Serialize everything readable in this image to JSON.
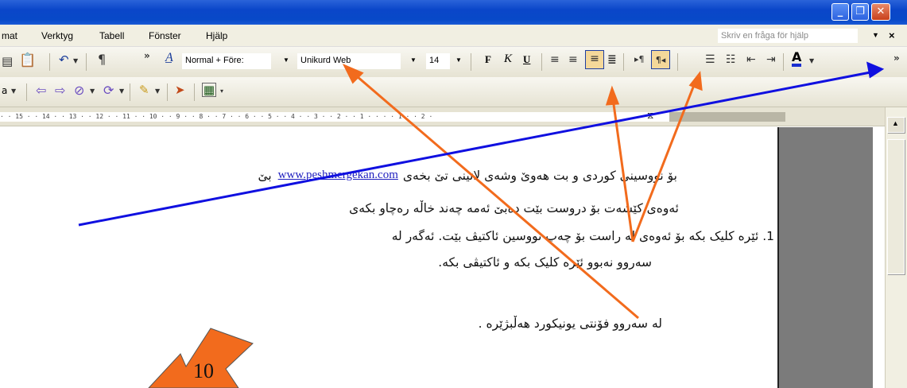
{
  "menubar": {
    "items": [
      "mat",
      "Verktyg",
      "Tabell",
      "Fönster",
      "Hjälp"
    ],
    "help_placeholder": "Skriv en fråga för hjälp"
  },
  "toolbar": {
    "style": "Normal + Före:",
    "font": "Unikurd Web",
    "size": "14",
    "bold": "F",
    "italic": "K",
    "underline": "U",
    "pilcrow": "¶",
    "font_color_letter": "A",
    "more": "»"
  },
  "toolbar2": {
    "left_label": "a"
  },
  "ruler": {
    "ticks": "· · 15 · · 14 · · 13 · · 12 · · 11 · · 10 · · 9 · · 8 · · 7 · · 6 · · 5 · · 4 · · 3 · · 2 · · 1 · · · · 1 · · 2 ·"
  },
  "document": {
    "line1_text": "بۆ نووسینی کوردی و بت هەوێ وشەی لاتینی تێ بخەی",
    "line1_link": "www.peshmergekan.com",
    "line1_end": "بێ",
    "line2": "ئەوەی کێشەت بۆ دروست بێت دەبێ ئەمە چەند خاڵە رەچاو بکەی",
    "line3": "1. ئێرە کلیک بکە بۆ ئەوەی لە راست بۆ چەپ نووسین ئاکتیڤ بێت. ئەگەر لە",
    "line4": "سەروو نەبوو ئێرە کلیک بکە و ئاکتیڤی بکە.",
    "line5": "لە سەروو فۆنتی یونیکورد هەڵبژێرە ."
  },
  "annotation": {
    "number": "10",
    "arrow_orange": "#f26b1d",
    "arrow_blue": "#1010e0"
  }
}
